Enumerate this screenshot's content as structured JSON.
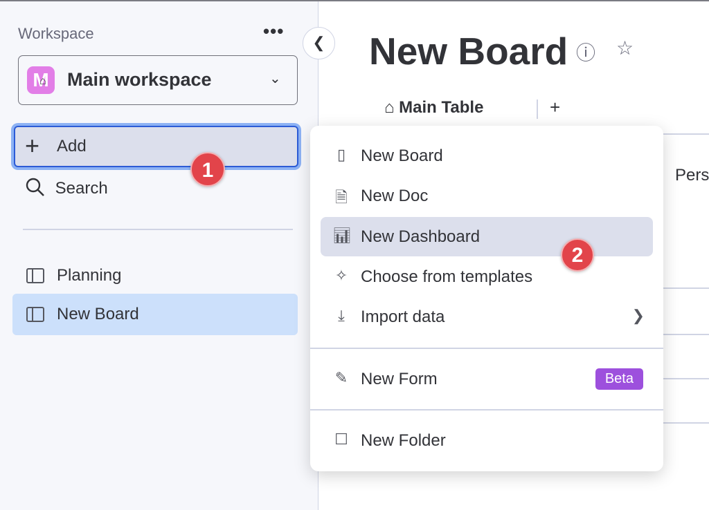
{
  "sidebar": {
    "workspace_label": "Workspace",
    "workspace": {
      "avatar_letter": "M",
      "name": "Main workspace"
    },
    "add_label": "Add",
    "search_label": "Search",
    "items": [
      {
        "label": "Planning",
        "selected": false
      },
      {
        "label": "New Board",
        "selected": true
      }
    ]
  },
  "main": {
    "title": "New Board",
    "tabs": [
      {
        "label": "Main Table"
      }
    ],
    "partial_column": "Pers"
  },
  "menu": {
    "items": [
      {
        "label": "New Board",
        "icon": "board-icon"
      },
      {
        "label": "New Doc",
        "icon": "doc-icon"
      },
      {
        "label": "New Dashboard",
        "icon": "dashboard-icon",
        "highlighted": true
      },
      {
        "label": "Choose from templates",
        "icon": "magic-wand-icon"
      },
      {
        "label": "Import data",
        "icon": "download-icon"
      },
      {
        "label": "New Form",
        "icon": "form-icon",
        "badge": "Beta"
      },
      {
        "label": "New Folder",
        "icon": "folder-icon"
      }
    ]
  },
  "annotations": {
    "step1": "1",
    "step2": "2"
  },
  "colors": {
    "accent": "#2c5bd6",
    "badge_red": "#e2444a",
    "beta": "#9d50dd",
    "selected": "#cce0fb",
    "avatar": "#e27ee7"
  }
}
